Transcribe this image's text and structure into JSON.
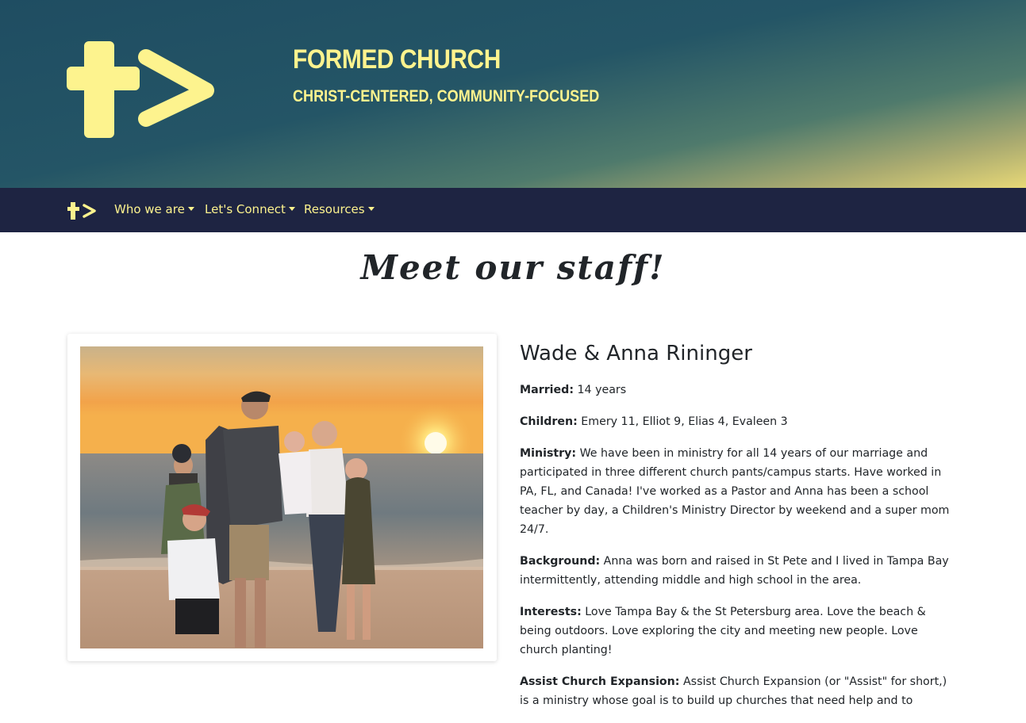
{
  "site": {
    "title": "Formed Church",
    "tagline": "Christ-Centered, Community-Focused",
    "brand_color": "#fdf38e",
    "nav_bg": "#1e2442"
  },
  "nav": {
    "brand_icon": "cross-arrow-logo-icon",
    "items": [
      {
        "label": "Who we are"
      },
      {
        "label": "Let's Connect"
      },
      {
        "label": "Resources"
      }
    ]
  },
  "page": {
    "title": "Meet our staff!"
  },
  "staff": {
    "name": "Wade & Anna Rininger",
    "photo_alt": "family photo on beach at sunset",
    "sections": [
      {
        "label": "Married:",
        "text": " 14 years"
      },
      {
        "label": "Children:",
        "text": " Emery 11, Elliot 9, Elias 4, Evaleen 3"
      },
      {
        "label": "Ministry:",
        "text": " We have been in ministry for all 14 years of our marriage and participated in three different church pants/campus starts. Have worked in PA, FL, and Canada! I've worked as a Pastor and Anna has been a school teacher by day, a Children's Ministry Director by weekend and a super mom 24/7."
      },
      {
        "label": "Background:",
        "text": " Anna was born and raised in St Pete and I lived in Tampa Bay intermittently, attending middle and high school in the area."
      },
      {
        "label": "Interests:",
        "text": " Love Tampa Bay & the St Petersburg area. Love the beach & being outdoors. Love exploring the city and meeting new people. Love church planting!"
      },
      {
        "label": "Assist Church Expansion:",
        "text": " Assist Church Expansion (or \"Assist\" for short,) is a ministry whose goal is to build up churches that need help and to"
      }
    ]
  }
}
